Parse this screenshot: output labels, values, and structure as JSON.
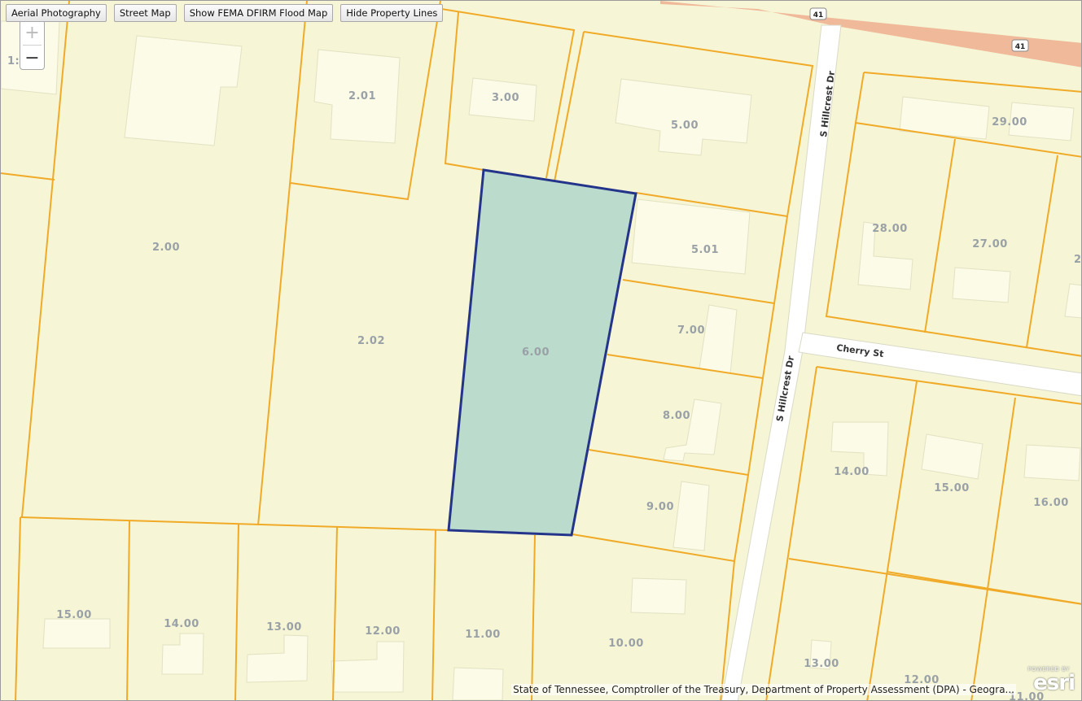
{
  "toolbar": {
    "aerial_label": "Aerial Photography",
    "street_label": "Street Map",
    "flood_label": "Show FEMA DFIRM Flood Map",
    "lines_label": "Hide Property Lines"
  },
  "zoom": {
    "in_symbol": "+",
    "out_symbol": "−"
  },
  "map": {
    "selected_parcel": "6.00",
    "parcels": {
      "p2_00": "2.00",
      "p2_01": "2.01",
      "p2_02": "2.02",
      "p3_00": "3.00",
      "p5_00": "5.00",
      "p5_01": "5.01",
      "p6_00": "6.00",
      "p7_00": "7.00",
      "p8_00": "8.00",
      "p9_00": "9.00",
      "p10_00": "10.00",
      "p11_00": "11.00",
      "p12_00_w": "12.00",
      "p13_00_w": "13.00",
      "p14_00_w": "14.00",
      "p15_00_w": "15.00",
      "p14_00_e": "14.00",
      "p15_00_e": "15.00",
      "p16_00": "16.00",
      "p13_00_e": "13.00",
      "p12_00_e": "12.00",
      "p27_00": "27.00",
      "p28_00": "28.00",
      "p29_00": "29.00",
      "p_edge_right": "2",
      "p_edge_left": "1:",
      "p_bottom_partial": "11.00"
    },
    "roads": {
      "hillcrest_north": "S Hillcrest Dr",
      "hillcrest_south": "S Hillcrest Dr",
      "cherry": "Cherry St"
    },
    "shields": {
      "highway_a": "41",
      "highway_b": "41"
    },
    "colors": {
      "background": "#f6f6d6",
      "parcel_line": "#f0aa28",
      "selected_fill": "#bbdbcd",
      "selected_stroke": "#24348a",
      "highway": "#efb99a",
      "road": "#ffffff"
    }
  },
  "attribution": "State of Tennessee, Comptroller of the Treasury, Department of Property Assessment (DPA) - Geogra...",
  "logo": {
    "powered_by": "POWERED BY",
    "name": "esri"
  }
}
